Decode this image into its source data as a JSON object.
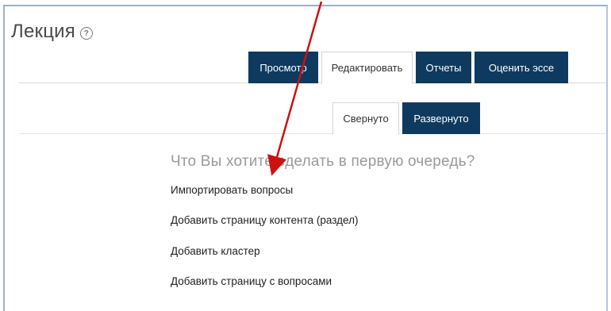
{
  "header": {
    "title": "Лекция",
    "help_icon": "question-circle-icon"
  },
  "tabs": [
    {
      "label": "Просмотр",
      "active": false
    },
    {
      "label": "Редактировать",
      "active": true
    },
    {
      "label": "Отчеты",
      "active": false
    },
    {
      "label": "Оценить эссе",
      "active": false
    }
  ],
  "subtabs": [
    {
      "label": "Свернуто",
      "active": true
    },
    {
      "label": "Развернуто",
      "active": false
    }
  ],
  "content": {
    "question": "Что Вы хотите сделать в первую очередь?",
    "options": [
      "Импортировать вопросы",
      "Добавить страницу контента (раздел)",
      "Добавить кластер",
      "Добавить страницу с вопросами"
    ]
  },
  "colors": {
    "tab_dark": "#0f3a5f",
    "arrow": "#cc1111",
    "frame": "#9fb0c6"
  }
}
